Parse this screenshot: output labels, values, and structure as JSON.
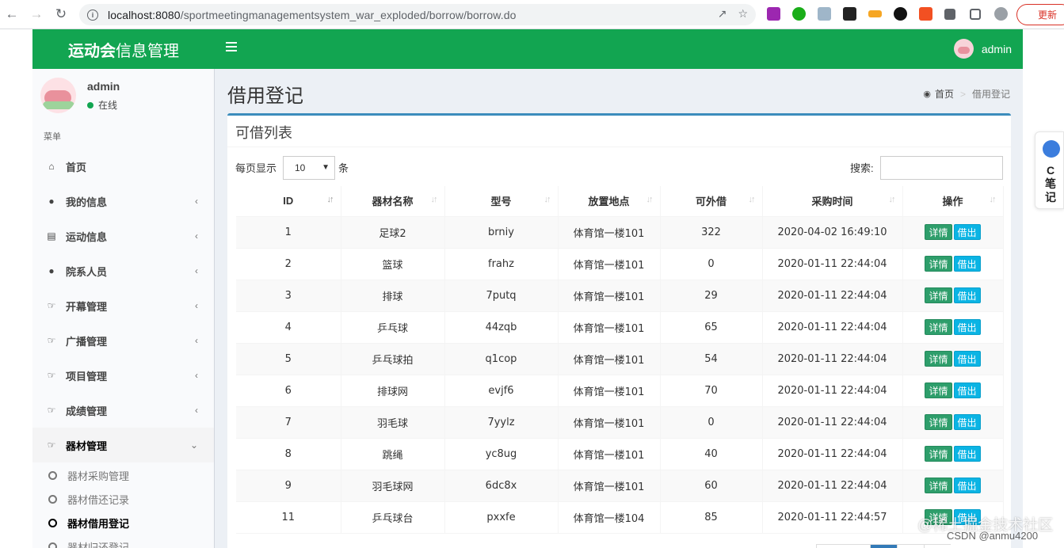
{
  "browser": {
    "url_host": "localhost:8080",
    "url_path": "/sportmeetingmanagementsystem_war_exploded/borrow/borrow.do",
    "update_label": "更新"
  },
  "header": {
    "logo_bold": "运动会",
    "logo_rest": "信息管理",
    "username": "admin"
  },
  "sidebar": {
    "username": "admin",
    "status": "在线",
    "menu_header": "菜单",
    "items": [
      {
        "label": "首页",
        "icon": "home-icon"
      },
      {
        "label": "我的信息",
        "icon": "user-icon"
      },
      {
        "label": "运动信息",
        "icon": "bar-chart-icon"
      },
      {
        "label": "院系人员",
        "icon": "users-icon"
      },
      {
        "label": "开幕管理",
        "icon": "hand-point-icon"
      },
      {
        "label": "广播管理",
        "icon": "hand-point-icon"
      },
      {
        "label": "项目管理",
        "icon": "hand-point-icon"
      },
      {
        "label": "成绩管理",
        "icon": "hand-point-icon"
      },
      {
        "label": "器材管理",
        "icon": "hand-point-icon"
      }
    ],
    "sub_items": [
      {
        "label": "器材采购管理"
      },
      {
        "label": "器材借还记录"
      },
      {
        "label": "器材借用登记"
      },
      {
        "label": "器材归还登记"
      }
    ]
  },
  "content": {
    "page_title": "借用登记",
    "breadcrumb_home": "首页",
    "breadcrumb_current": "借用登记",
    "box_title": "可借列表",
    "length_label": "每页显示",
    "length_value": "10",
    "length_suffix": "条",
    "search_label": "搜索:"
  },
  "table": {
    "columns": [
      "ID",
      "器材名称",
      "型号",
      "放置地点",
      "可外借",
      "采购时间",
      "操作"
    ],
    "detail_label": "详情",
    "borrow_label": "借出",
    "rows": [
      {
        "id": "1",
        "name": "足球2",
        "model": "brniy",
        "location": "体育馆一楼101",
        "available": "322",
        "time": "2020-04-02 16:49:10"
      },
      {
        "id": "2",
        "name": "篮球",
        "model": "frahz",
        "location": "体育馆一楼101",
        "available": "0",
        "time": "2020-01-11 22:44:04"
      },
      {
        "id": "3",
        "name": "排球",
        "model": "7putq",
        "location": "体育馆一楼101",
        "available": "29",
        "time": "2020-01-11 22:44:04"
      },
      {
        "id": "4",
        "name": "乒乓球",
        "model": "44zqb",
        "location": "体育馆一楼101",
        "available": "65",
        "time": "2020-01-11 22:44:04"
      },
      {
        "id": "5",
        "name": "乒乓球拍",
        "model": "q1cop",
        "location": "体育馆一楼101",
        "available": "54",
        "time": "2020-01-11 22:44:04"
      },
      {
        "id": "6",
        "name": "排球网",
        "model": "evjf6",
        "location": "体育馆一楼101",
        "available": "70",
        "time": "2020-01-11 22:44:04"
      },
      {
        "id": "7",
        "name": "羽毛球",
        "model": "7yylz",
        "location": "体育馆一楼101",
        "available": "0",
        "time": "2020-01-11 22:44:04"
      },
      {
        "id": "8",
        "name": "跳绳",
        "model": "yc8ug",
        "location": "体育馆一楼101",
        "available": "40",
        "time": "2020-01-11 22:44:04"
      },
      {
        "id": "9",
        "name": "羽毛球网",
        "model": "6dc8x",
        "location": "体育馆一楼101",
        "available": "60",
        "time": "2020-01-11 22:44:04"
      },
      {
        "id": "11",
        "name": "乒乓球台",
        "model": "pxxfe",
        "location": "体育馆一楼104",
        "available": "85",
        "time": "2020-01-11 22:44:57"
      }
    ]
  },
  "widget": {
    "text": "C笔记"
  },
  "watermark": {
    "line1": "@稀土掘金技术社区",
    "line2": "CSDN @anmu4200"
  },
  "colors": {
    "header_green": "#12a551",
    "box_border": "#3c8dbc",
    "btn_detail": "#2e9e6b",
    "btn_borrow": "#0bb4e4"
  }
}
